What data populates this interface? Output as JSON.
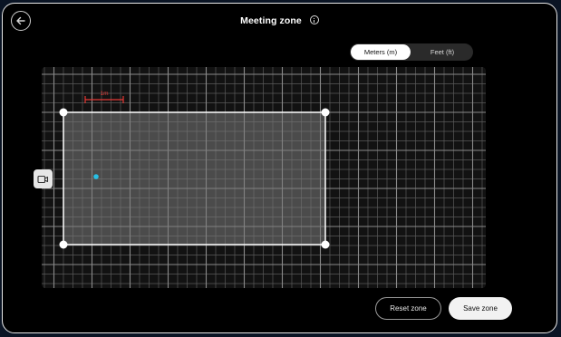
{
  "header": {
    "title": "Meeting zone",
    "back_icon": "arrow-left-icon",
    "info_icon": "info-icon"
  },
  "unit_toggle": {
    "options": [
      "Meters (m)",
      "Feet (ft)"
    ],
    "selected": "Meters (m)"
  },
  "zone_editor": {
    "scale_label": "1m",
    "camera_icon": "camera-icon",
    "colors": {
      "grid_line": "#5a5a5a",
      "grid_major": "#8a8a8a",
      "zone_fill": "#7a7a7a",
      "marker": "#27c0e6",
      "scale_line": "#e53935"
    }
  },
  "actions": {
    "reset_label": "Reset zone",
    "save_label": "Save zone"
  }
}
